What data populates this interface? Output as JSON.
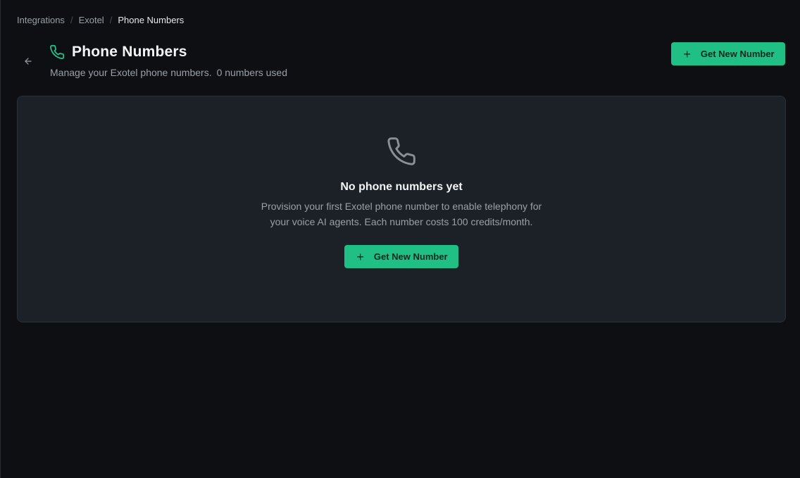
{
  "breadcrumb": {
    "items": [
      "Integrations",
      "Exotel"
    ],
    "current": "Phone Numbers",
    "separator": "/"
  },
  "header": {
    "title": "Phone Numbers",
    "subtitle": "Manage your Exotel phone numbers.",
    "usage": "0 numbers used",
    "action_label": "Get New Number"
  },
  "empty_state": {
    "title": "No phone numbers yet",
    "description": "Provision your first Exotel phone number to enable telephony for your voice AI agents. Each number costs 100 credits/month.",
    "action_label": "Get New Number"
  },
  "icons": {
    "back": "arrow-left-icon",
    "title": "phone-icon",
    "empty": "phone-icon",
    "add": "plus-icon"
  },
  "colors": {
    "accent": "#1fbf86",
    "background": "#0d0f13",
    "card": "#1c2027"
  }
}
